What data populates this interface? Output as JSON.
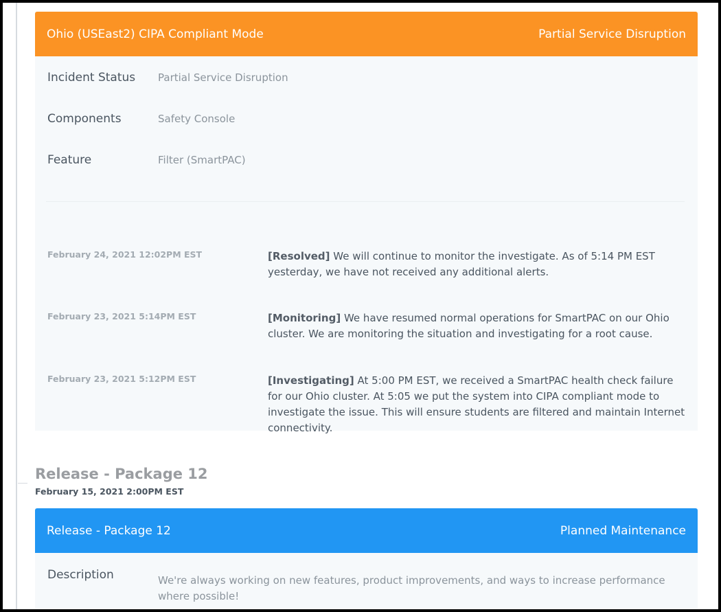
{
  "incident": {
    "title": "Ohio (USEast2) CIPA Compliant Mode",
    "status_badge": "Partial Service Disruption",
    "header_color": "#fb9324",
    "details": [
      {
        "label": "Incident Status",
        "value": "Partial Service Disruption"
      },
      {
        "label": "Components",
        "value": "Safety Console"
      },
      {
        "label": "Feature",
        "value": "Filter (SmartPAC)"
      }
    ],
    "updates": [
      {
        "date": "February 24, 2021 12:02PM EST",
        "status": "[Resolved]",
        "message": "We will continue to monitor the investigate. As of 5:14 PM EST yesterday, we have not received any additional alerts."
      },
      {
        "date": "February 23, 2021 5:14PM EST",
        "status": "[Monitoring]",
        "message": "We have resumed normal operations for SmartPAC on our Ohio cluster. We are monitoring the situation and investigating for a root cause."
      },
      {
        "date": "February 23, 2021 5:12PM EST",
        "status": "[Investigating]",
        "message": "At 5:00 PM EST, we received a SmartPAC health check failure for our Ohio cluster. At 5:05 we put the system into  CIPA compliant mode to investigate the issue. This will ensure students are filtered and maintain Internet connectivity."
      }
    ]
  },
  "release": {
    "heading": "Release - Package 12",
    "date": "February 15, 2021 2:00PM EST",
    "card_title": "Release - Package 12",
    "status_badge": "Planned Maintenance",
    "header_color": "#2196f3",
    "description_label": "Description",
    "description": "We're always working on new features, product improvements, and ways to increase performance where possible!"
  }
}
